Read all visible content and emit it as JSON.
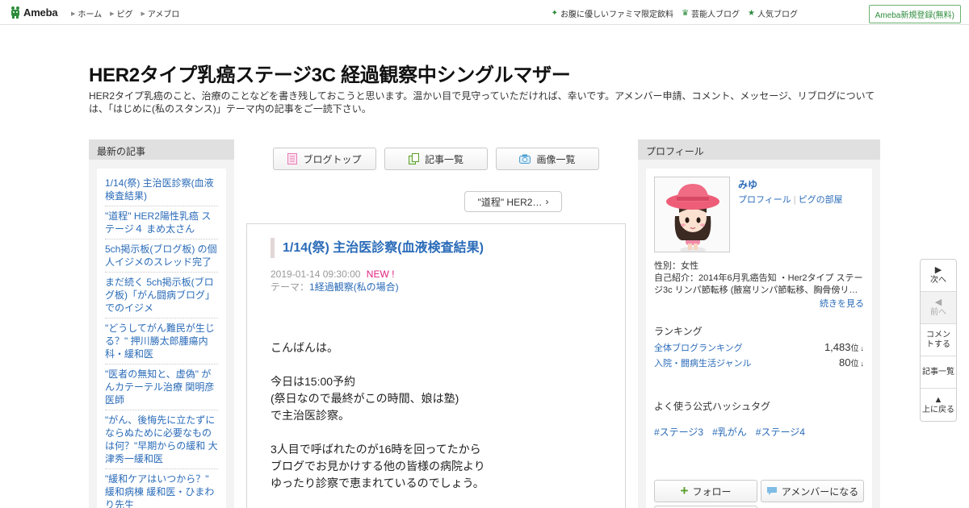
{
  "header": {
    "logo_text": "Ameba",
    "nav": [
      "ホーム",
      "ピグ",
      "アメブロ"
    ],
    "right_links": [
      {
        "icon": "sparkle-icon",
        "label": "お腹に優しいファミマ限定飲料"
      },
      {
        "icon": "crown-icon",
        "label": "芸能人ブログ"
      },
      {
        "icon": "star-icon",
        "label": "人気ブログ"
      }
    ],
    "signup_label": "Ameba新規登録(無料)"
  },
  "blog": {
    "title": "HER2タイプ乳癌ステージ3C 経過観察中シングルマザー",
    "description": "HER2タイプ乳癌のこと、治療のことなどを書き残しておこうと思います。温かい目で見守っていただければ、幸いです。アメンバー申請、コメント、メッセージ、リブログについては、「はじめに(私のスタンス)」テーマ内の記事をご一読下さい。"
  },
  "left": {
    "heading": "最新の記事",
    "items": [
      "1/14(祭) 主治医診察(血液検査結果)",
      "\"道程\" HER2陽性乳癌 ステージ４ まめ太さん",
      "5ch掲示板(ブログ板) の個人イジメのスレッド完了",
      "まだ続く 5ch掲示板(ブログ板)「がん闘病ブログ」でのイジメ",
      "\"どうしてがん難民が生じる？\" 押川勝太郎腫瘍内科・緩和医",
      "\"医者の無知と、虚偽\" がんカテーテル治療 関明彦医師",
      "\"がん、後悔先に立たずにならぬために必要なものは何？\"早期からの緩和 大津秀一緩和医",
      "\"緩和ケアはいつから？\" 緩和病棟 緩和医・ひまわり先生"
    ]
  },
  "center": {
    "tabs": [
      {
        "icon": "document-icon",
        "label": "ブログトップ"
      },
      {
        "icon": "list-icon",
        "label": "記事一覧"
      },
      {
        "icon": "camera-icon",
        "label": "画像一覧"
      }
    ],
    "prev_label": "\"道程\" HER2…",
    "entry": {
      "title": "1/14(祭) 主治医診察(血液検査結果)",
      "date": "2019-01-14 09:30:00",
      "new_badge": "NEW !",
      "theme_label": "テーマ：",
      "theme": "1経過観察(私の場合)",
      "body": [
        "こんばんは。",
        "",
        "今日は15:00予約",
        "(祭日なので最終がこの時間、娘は塾)",
        "で主治医診察。",
        "",
        "3人目で呼ばれたのが16時を回ってたから",
        "ブログでお見かけする他の皆様の病院より",
        "ゆったり診察で恵まれているのでしょう。"
      ]
    }
  },
  "right": {
    "heading": "プロフィール",
    "name": "みゆ",
    "links": [
      "プロフィール",
      "ピグの部屋"
    ],
    "gender": "性別：女性",
    "intro": "自己紹介：2014年6月乳癌告知 ・Her2タイプ ステージ3c リンパ節転移 (腋窩リンパ節転移、胸骨傍リ…",
    "more": "続きを見る",
    "ranking_heading": "ランキング",
    "rankings": [
      {
        "label": "全体ブログランキング",
        "value": "1,483",
        "unit": "位",
        "arrow": "↓"
      },
      {
        "label": "入院・闘病生活ジャンル",
        "value": "80",
        "unit": "位",
        "arrow": "↓"
      }
    ],
    "hashtag_heading": "よく使う公式ハッシュタグ",
    "hashtags": [
      "#ステージ3",
      "#乳がん",
      "#ステージ4"
    ],
    "follow_label": "フォロー",
    "amember_label": "アメンバーになる"
  },
  "sidenav": {
    "next": "次へ",
    "prev": "前へ",
    "comment": "コメントする",
    "list": "記事一覧",
    "top": "上に戻る"
  },
  "colors": {
    "link": "#2a6bb8",
    "brand_green": "#2d8c3c",
    "new_badge": "#e2237f"
  }
}
